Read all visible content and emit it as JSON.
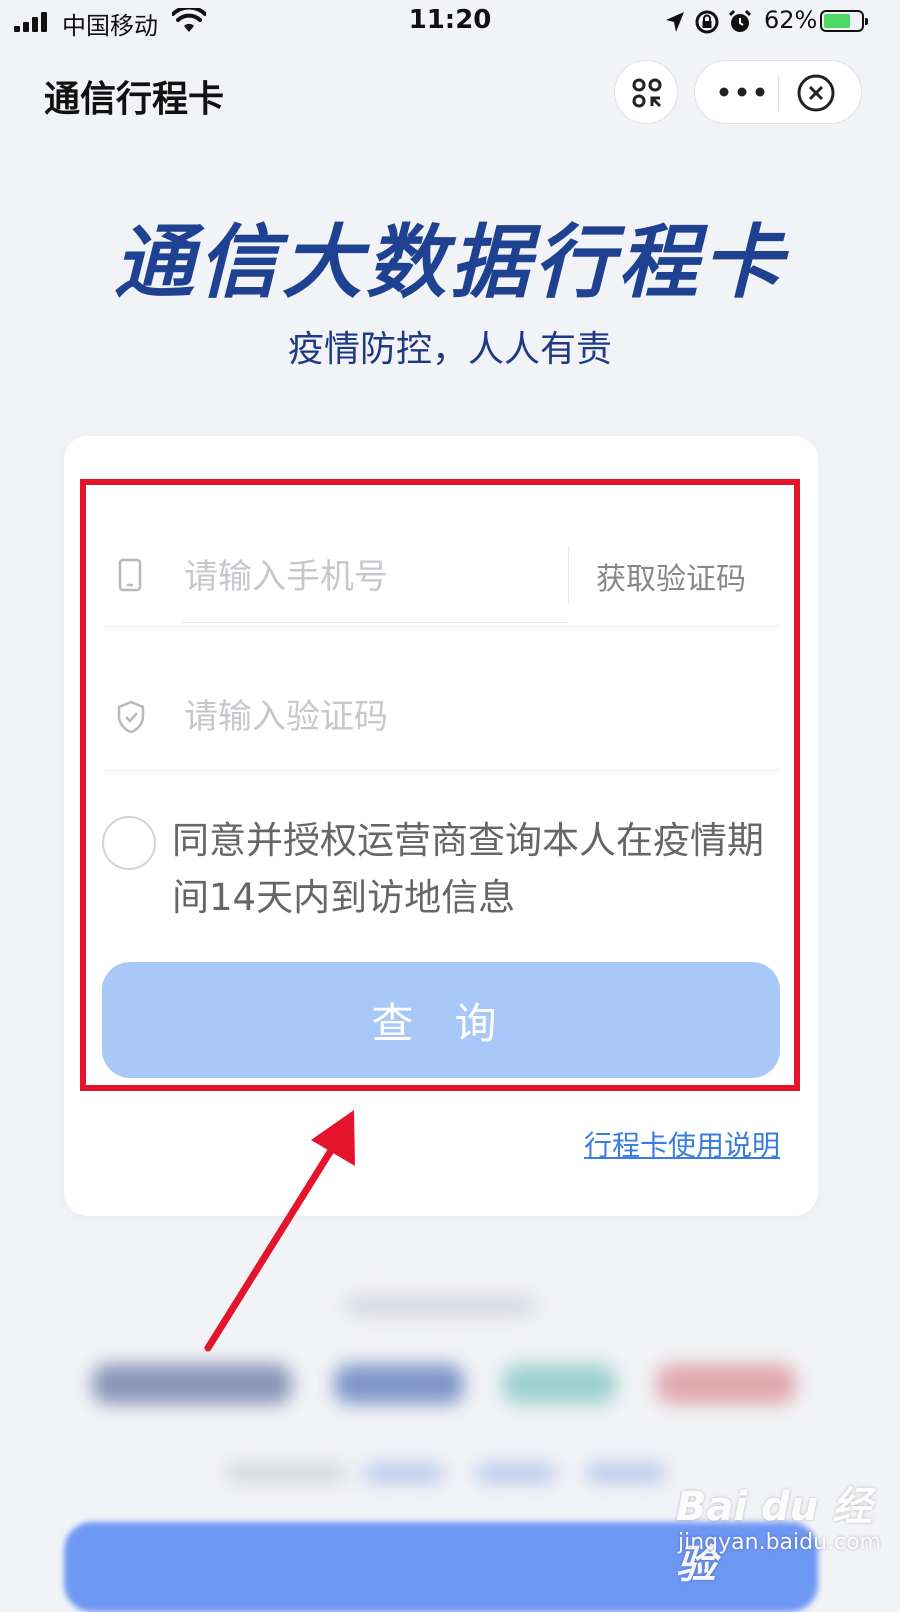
{
  "status_bar": {
    "carrier": "中国移动",
    "time": "11:20",
    "battery_percent": "62%",
    "icons": [
      "signal-icon",
      "wifi-icon",
      "location-icon",
      "rotation-lock-icon",
      "alarm-icon",
      "battery-charging-icon"
    ]
  },
  "nav": {
    "title": "通信行程卡",
    "icons": [
      "scan-icon",
      "more-icon",
      "close-icon"
    ]
  },
  "hero": {
    "title": "通信大数据行程卡",
    "subtitle": "疫情防控，人人有责"
  },
  "form": {
    "phone_placeholder": "请输入手机号",
    "get_code_label": "获取验证码",
    "code_placeholder": "请输入验证码",
    "agreement_text": "同意并授权运营商查询本人在疫情期间14天内到访地信息",
    "agreement_checked": false,
    "query_button_label": "查 询",
    "help_link": "行程卡使用说明",
    "icons": [
      "phone-icon",
      "shield-icon"
    ]
  },
  "annotation": {
    "highlight_color": "#e3142b"
  },
  "watermark": {
    "logo_text": "Bai du 经验",
    "url": "jingyan.baidu.com"
  },
  "colors": {
    "brand_title": "#1e4291",
    "query_button": "#a8c8f8",
    "link": "#3a7de0"
  }
}
